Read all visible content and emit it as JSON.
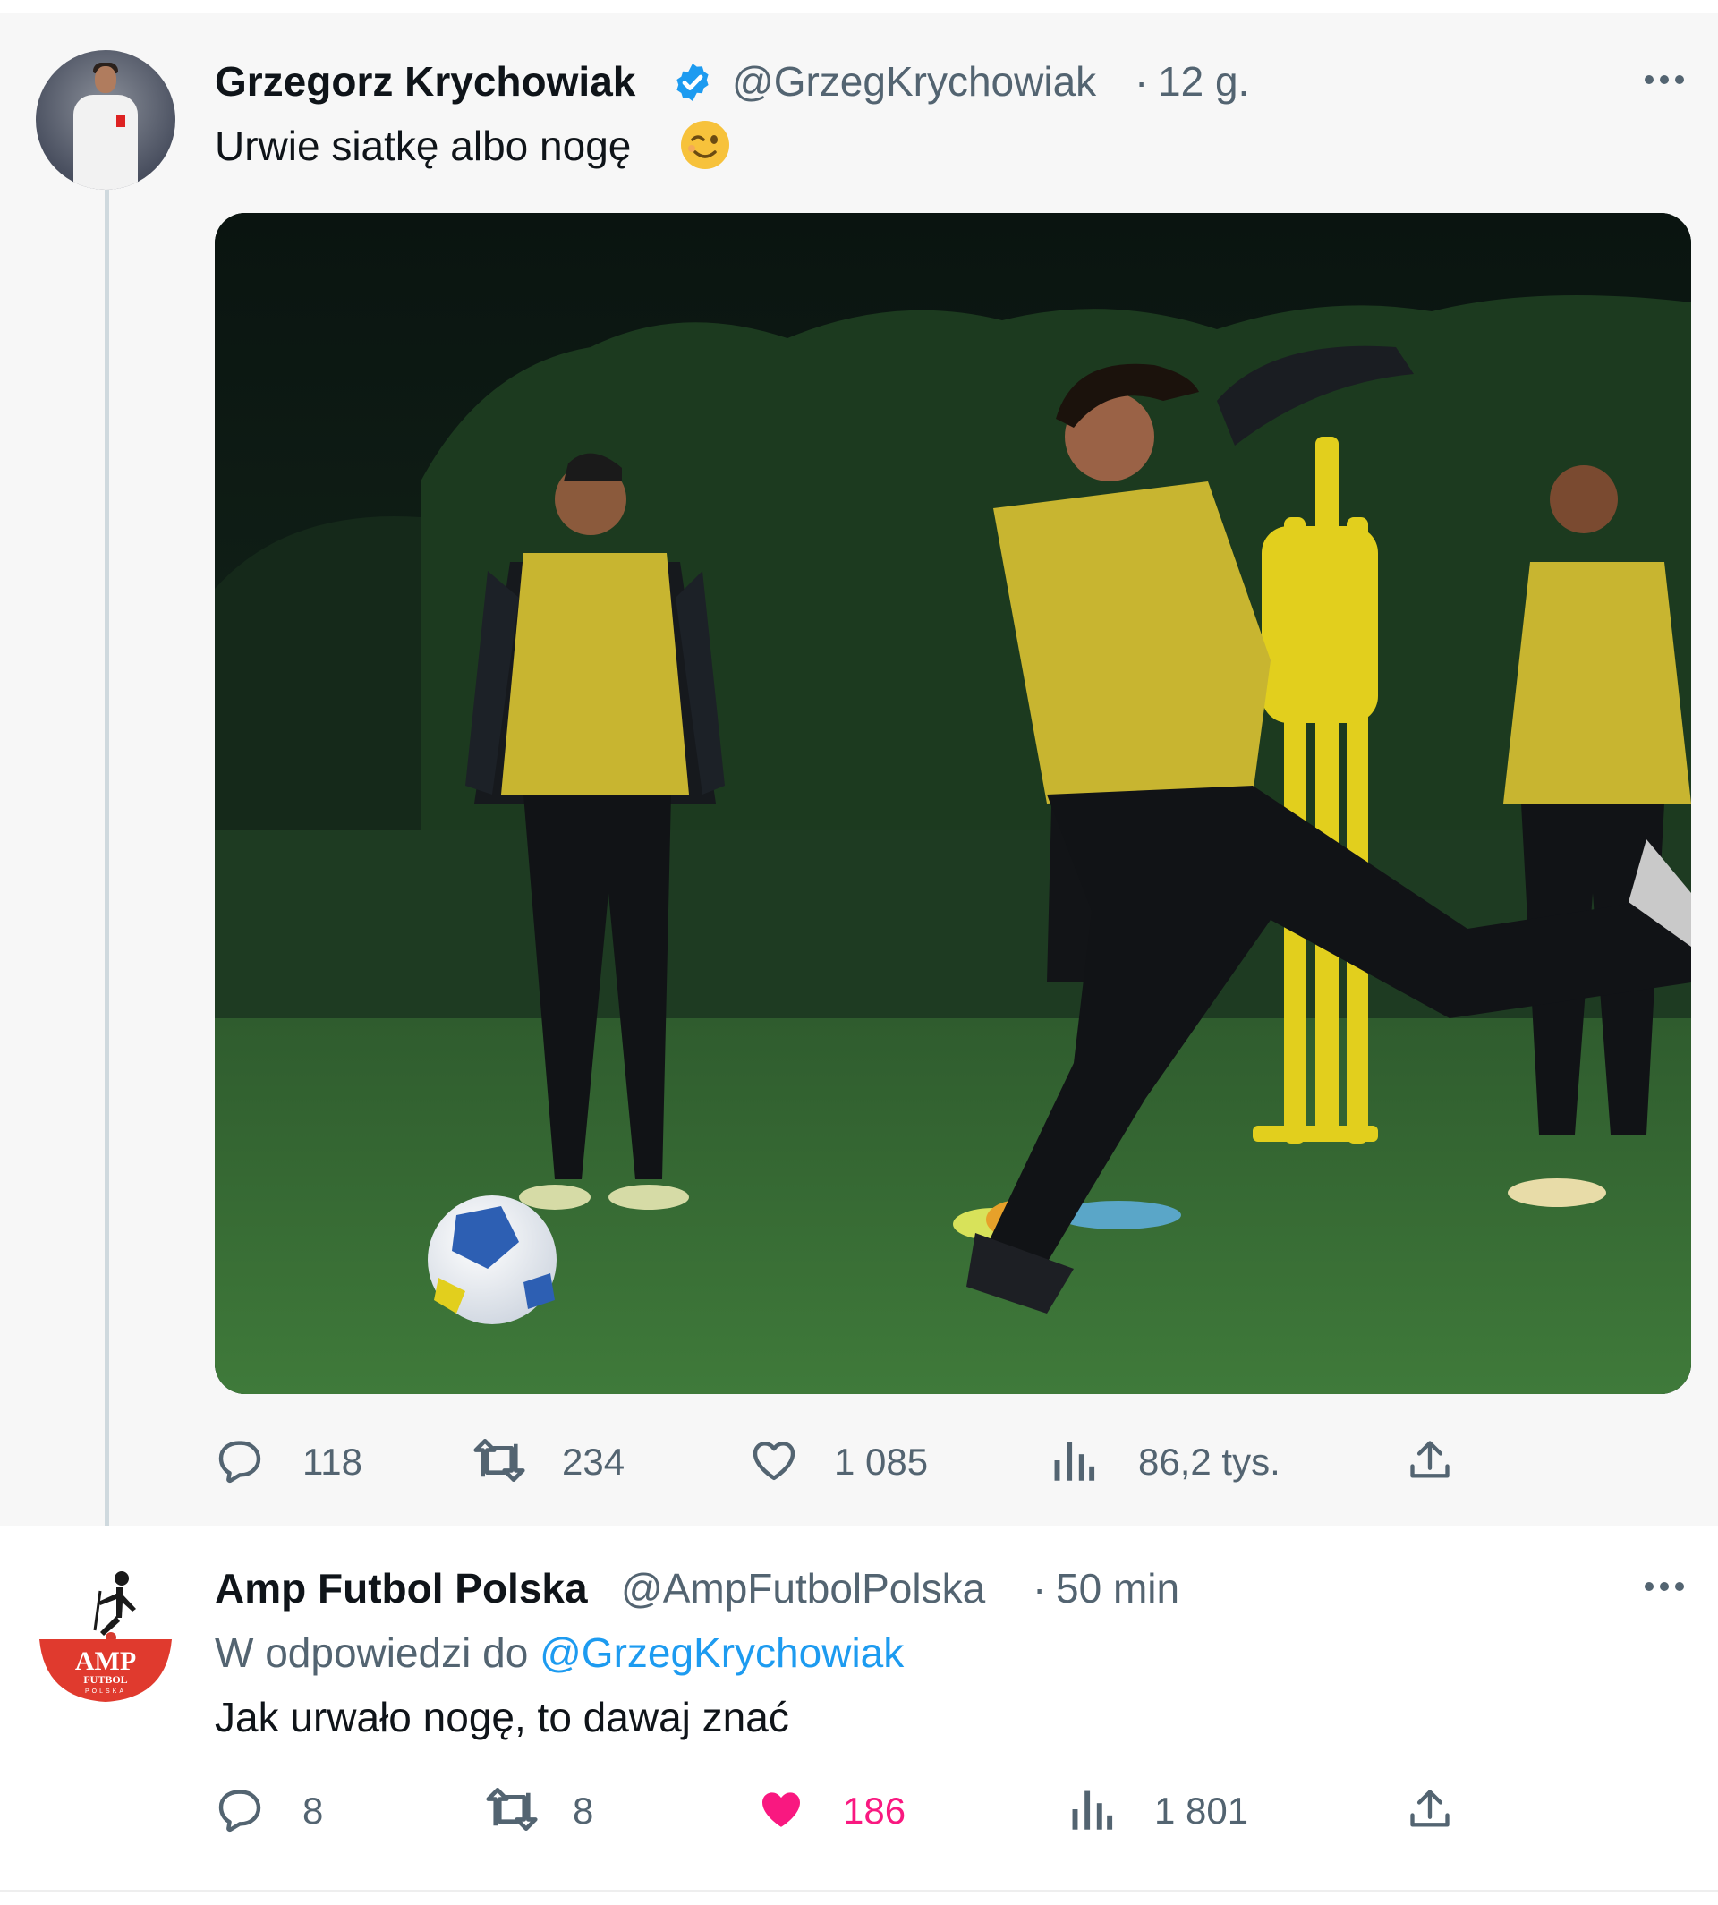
{
  "tweet": {
    "author_name": "Grzegorz Krychowiak",
    "author_handle": "@GrzegKrychowiak",
    "separator": "·",
    "time": "12 g.",
    "text": "Urwie siatkę albo nogę",
    "emoji": "winking-face",
    "verified": true,
    "stats": {
      "replies": "118",
      "retweets": "234",
      "likes": "1 085",
      "views": "86,2 tys."
    }
  },
  "reply": {
    "author_name": "Amp Futbol Polska",
    "author_handle": "@AmpFutbolPolska",
    "separator": "·",
    "time": "50 min",
    "reply_prefix": "W odpowiedzi do",
    "reply_to": "@GrzegKrychowiak",
    "text": "Jak urwało nogę, to dawaj znać",
    "logo_text": "AMP",
    "logo_subtext": "FUTBOL",
    "logo_small": "POLSKA",
    "liked": true,
    "stats": {
      "replies": "8",
      "retweets": "8",
      "likes": "186",
      "views": "1 801"
    }
  },
  "icons": {
    "more": "more-icon",
    "reply": "reply-icon",
    "retweet": "retweet-icon",
    "like": "heart-icon",
    "views": "views-icon",
    "share": "share-icon"
  },
  "colors": {
    "verified_blue": "#1d9bf0",
    "like_pink": "#f91880",
    "muted": "#536471",
    "bib_yellow": "#c8b530"
  }
}
